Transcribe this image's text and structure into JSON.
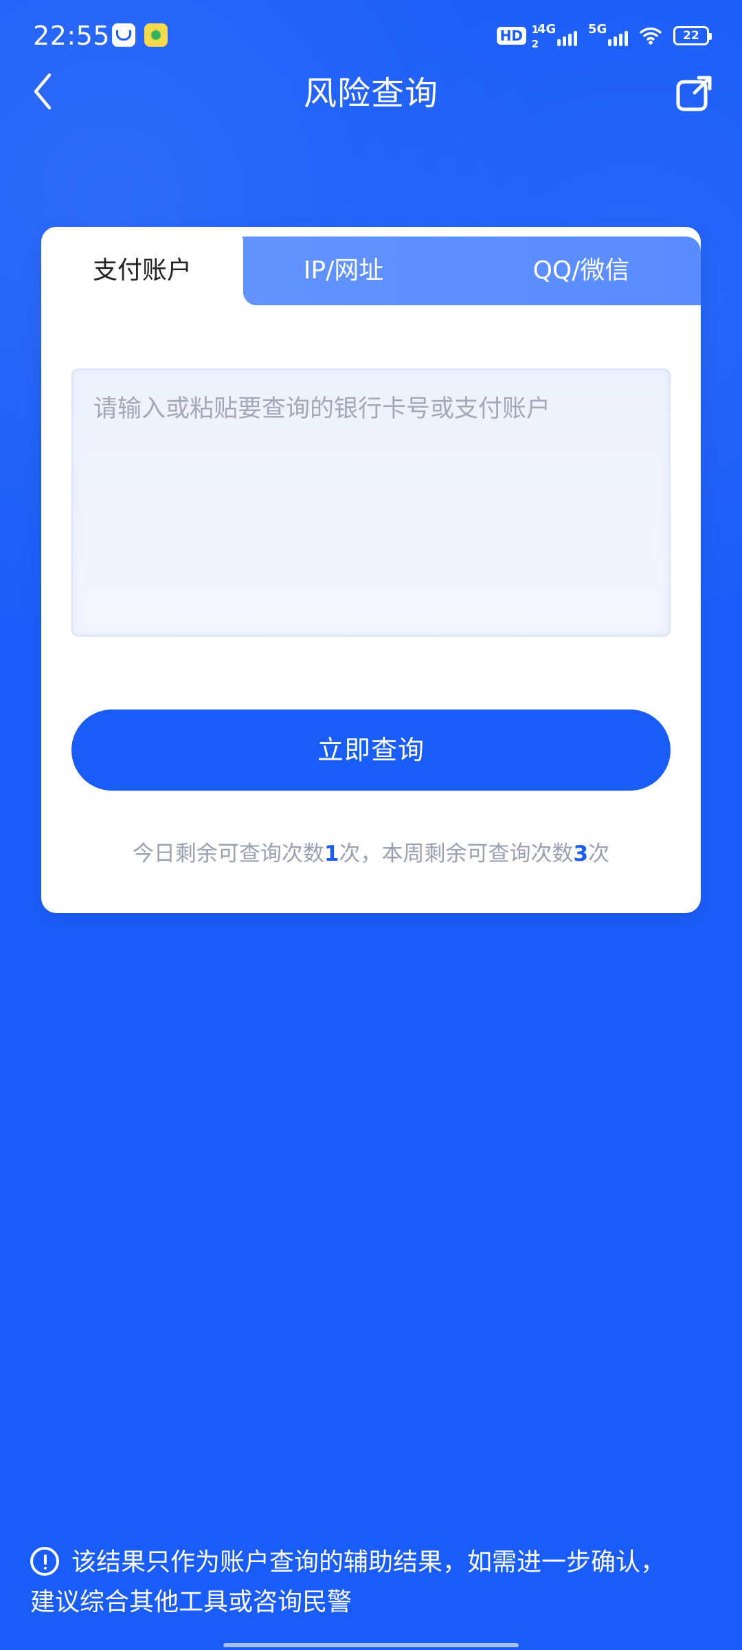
{
  "status": {
    "time": "22:55",
    "network_hd": "HD",
    "network_hd_sub_top": "1",
    "network_hd_sub_bottom": "2",
    "network_4g": "4G",
    "network_5g": "5G",
    "battery": "22"
  },
  "header": {
    "title": "风险查询",
    "back_icon": "chevron-left-icon",
    "share_icon": "share-external-icon"
  },
  "tabs": [
    {
      "label": "支付账户",
      "active": true
    },
    {
      "label": "IP/网址",
      "active": false
    },
    {
      "label": "QQ/微信",
      "active": false
    }
  ],
  "query": {
    "placeholder": "请输入或粘贴要查询的银行卡号或支付账户",
    "button_label": "立即查询"
  },
  "usage": {
    "prefix": "今日剩余可查询次数",
    "today_count": "1",
    "middle": "次，本周剩余可查询次数",
    "week_count": "3",
    "suffix": "次"
  },
  "notice": {
    "icon": "info-circle-icon",
    "line1": "该结果只作为账户查询的辅助结果，如需进一步确认，",
    "line2": "建议综合其他工具或咨询民警"
  },
  "colors": {
    "primary": "#1a5cf8",
    "tab_inactive": "#5a8cff",
    "usage_text": "#9aa0b2"
  }
}
